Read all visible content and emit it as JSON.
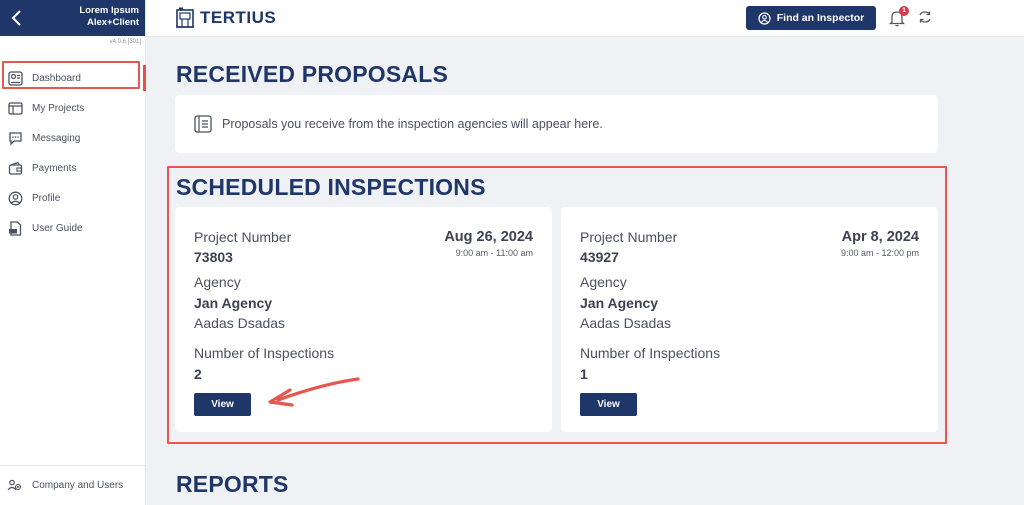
{
  "sidebar": {
    "user_name": "Lorem Ipsum",
    "user_role": "Alex+Client",
    "version": "v4.0.6 [301]",
    "items": [
      {
        "label": "Dashboard",
        "icon": "dashboard-icon",
        "active": true
      },
      {
        "label": "My Projects",
        "icon": "projects-icon"
      },
      {
        "label": "Messaging",
        "icon": "chat-icon"
      },
      {
        "label": "Payments",
        "icon": "wallet-icon"
      },
      {
        "label": "Profile",
        "icon": "user-icon"
      },
      {
        "label": "User Guide",
        "icon": "pdf-icon"
      }
    ],
    "bottom": {
      "label": "Company and Users",
      "icon": "users-icon"
    }
  },
  "header": {
    "logo": "TERTIUS",
    "find_button": "Find an Inspector",
    "notification_count": "1"
  },
  "received": {
    "title": "RECEIVED PROPOSALS",
    "notice": "Proposals you receive from the inspection agencies will appear here."
  },
  "scheduled": {
    "title": "SCHEDULED INSPECTIONS",
    "cards": [
      {
        "project_label": "Project Number",
        "project_number": "73803",
        "date": "Aug 26, 2024",
        "time": "9:00 am - 11:00 am",
        "agency_label": "Agency",
        "agency": "Jan Agency",
        "contact": "Aadas Dsadas",
        "inspections_label": "Number of Inspections",
        "inspections": "2",
        "button": "View"
      },
      {
        "project_label": "Project Number",
        "project_number": "43927",
        "date": "Apr 8, 2024",
        "time": "9:00 am - 12:00 pm",
        "agency_label": "Agency",
        "agency": "Jan Agency",
        "contact": "Aadas Dsadas",
        "inspections_label": "Number of Inspections",
        "inspections": "1",
        "button": "View"
      }
    ]
  },
  "reports": {
    "title": "REPORTS"
  },
  "colors": {
    "primary": "#1e3768",
    "highlight": "#e8574f",
    "badge": "#d8384a"
  }
}
